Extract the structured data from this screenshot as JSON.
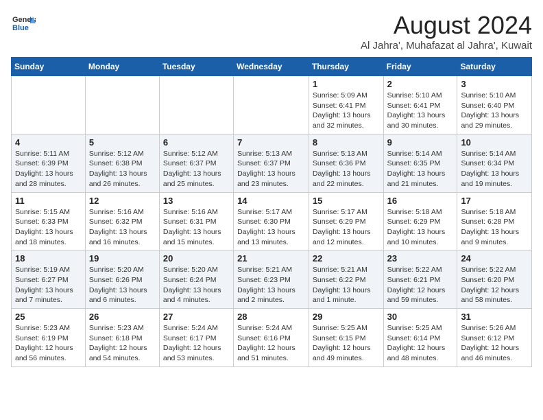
{
  "header": {
    "logo_line1": "General",
    "logo_line2": "Blue",
    "month_title": "August 2024",
    "subtitle": "Al Jahra', Muhafazat al Jahra', Kuwait"
  },
  "days_of_week": [
    "Sunday",
    "Monday",
    "Tuesday",
    "Wednesday",
    "Thursday",
    "Friday",
    "Saturday"
  ],
  "weeks": [
    [
      {
        "day": "",
        "info": ""
      },
      {
        "day": "",
        "info": ""
      },
      {
        "day": "",
        "info": ""
      },
      {
        "day": "",
        "info": ""
      },
      {
        "day": "1",
        "info": "Sunrise: 5:09 AM\nSunset: 6:41 PM\nDaylight: 13 hours\nand 32 minutes."
      },
      {
        "day": "2",
        "info": "Sunrise: 5:10 AM\nSunset: 6:41 PM\nDaylight: 13 hours\nand 30 minutes."
      },
      {
        "day": "3",
        "info": "Sunrise: 5:10 AM\nSunset: 6:40 PM\nDaylight: 13 hours\nand 29 minutes."
      }
    ],
    [
      {
        "day": "4",
        "info": "Sunrise: 5:11 AM\nSunset: 6:39 PM\nDaylight: 13 hours\nand 28 minutes."
      },
      {
        "day": "5",
        "info": "Sunrise: 5:12 AM\nSunset: 6:38 PM\nDaylight: 13 hours\nand 26 minutes."
      },
      {
        "day": "6",
        "info": "Sunrise: 5:12 AM\nSunset: 6:37 PM\nDaylight: 13 hours\nand 25 minutes."
      },
      {
        "day": "7",
        "info": "Sunrise: 5:13 AM\nSunset: 6:37 PM\nDaylight: 13 hours\nand 23 minutes."
      },
      {
        "day": "8",
        "info": "Sunrise: 5:13 AM\nSunset: 6:36 PM\nDaylight: 13 hours\nand 22 minutes."
      },
      {
        "day": "9",
        "info": "Sunrise: 5:14 AM\nSunset: 6:35 PM\nDaylight: 13 hours\nand 21 minutes."
      },
      {
        "day": "10",
        "info": "Sunrise: 5:14 AM\nSunset: 6:34 PM\nDaylight: 13 hours\nand 19 minutes."
      }
    ],
    [
      {
        "day": "11",
        "info": "Sunrise: 5:15 AM\nSunset: 6:33 PM\nDaylight: 13 hours\nand 18 minutes."
      },
      {
        "day": "12",
        "info": "Sunrise: 5:16 AM\nSunset: 6:32 PM\nDaylight: 13 hours\nand 16 minutes."
      },
      {
        "day": "13",
        "info": "Sunrise: 5:16 AM\nSunset: 6:31 PM\nDaylight: 13 hours\nand 15 minutes."
      },
      {
        "day": "14",
        "info": "Sunrise: 5:17 AM\nSunset: 6:30 PM\nDaylight: 13 hours\nand 13 minutes."
      },
      {
        "day": "15",
        "info": "Sunrise: 5:17 AM\nSunset: 6:29 PM\nDaylight: 13 hours\nand 12 minutes."
      },
      {
        "day": "16",
        "info": "Sunrise: 5:18 AM\nSunset: 6:29 PM\nDaylight: 13 hours\nand 10 minutes."
      },
      {
        "day": "17",
        "info": "Sunrise: 5:18 AM\nSunset: 6:28 PM\nDaylight: 13 hours\nand 9 minutes."
      }
    ],
    [
      {
        "day": "18",
        "info": "Sunrise: 5:19 AM\nSunset: 6:27 PM\nDaylight: 13 hours\nand 7 minutes."
      },
      {
        "day": "19",
        "info": "Sunrise: 5:20 AM\nSunset: 6:26 PM\nDaylight: 13 hours\nand 6 minutes."
      },
      {
        "day": "20",
        "info": "Sunrise: 5:20 AM\nSunset: 6:24 PM\nDaylight: 13 hours\nand 4 minutes."
      },
      {
        "day": "21",
        "info": "Sunrise: 5:21 AM\nSunset: 6:23 PM\nDaylight: 13 hours\nand 2 minutes."
      },
      {
        "day": "22",
        "info": "Sunrise: 5:21 AM\nSunset: 6:22 PM\nDaylight: 13 hours\nand 1 minute."
      },
      {
        "day": "23",
        "info": "Sunrise: 5:22 AM\nSunset: 6:21 PM\nDaylight: 12 hours\nand 59 minutes."
      },
      {
        "day": "24",
        "info": "Sunrise: 5:22 AM\nSunset: 6:20 PM\nDaylight: 12 hours\nand 58 minutes."
      }
    ],
    [
      {
        "day": "25",
        "info": "Sunrise: 5:23 AM\nSunset: 6:19 PM\nDaylight: 12 hours\nand 56 minutes."
      },
      {
        "day": "26",
        "info": "Sunrise: 5:23 AM\nSunset: 6:18 PM\nDaylight: 12 hours\nand 54 minutes."
      },
      {
        "day": "27",
        "info": "Sunrise: 5:24 AM\nSunset: 6:17 PM\nDaylight: 12 hours\nand 53 minutes."
      },
      {
        "day": "28",
        "info": "Sunrise: 5:24 AM\nSunset: 6:16 PM\nDaylight: 12 hours\nand 51 minutes."
      },
      {
        "day": "29",
        "info": "Sunrise: 5:25 AM\nSunset: 6:15 PM\nDaylight: 12 hours\nand 49 minutes."
      },
      {
        "day": "30",
        "info": "Sunrise: 5:25 AM\nSunset: 6:14 PM\nDaylight: 12 hours\nand 48 minutes."
      },
      {
        "day": "31",
        "info": "Sunrise: 5:26 AM\nSunset: 6:12 PM\nDaylight: 12 hours\nand 46 minutes."
      }
    ]
  ]
}
